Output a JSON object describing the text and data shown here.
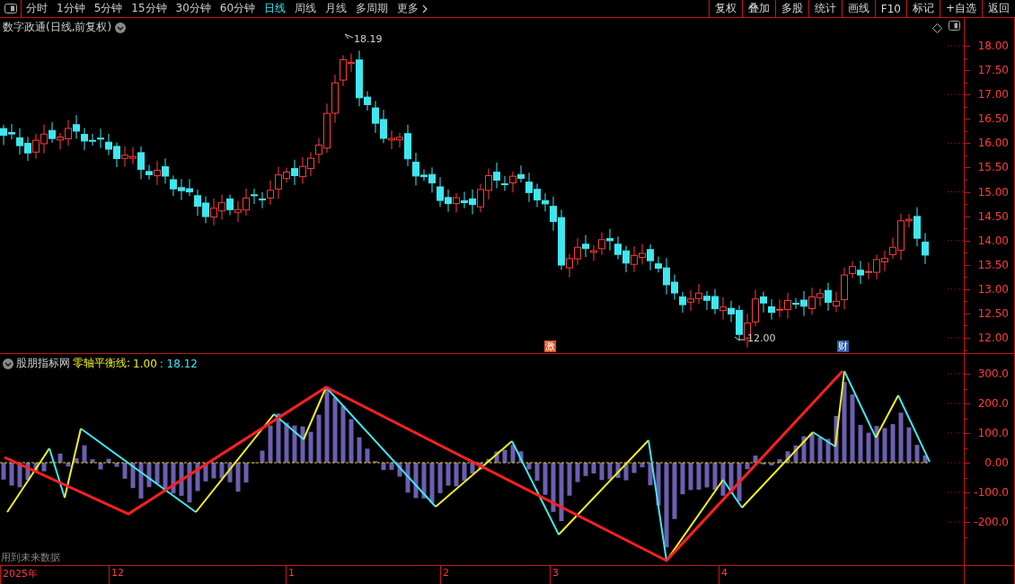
{
  "toolbar": {
    "periods": [
      {
        "label": "分时",
        "selected": false
      },
      {
        "label": "1分钟",
        "selected": false
      },
      {
        "label": "5分钟",
        "selected": false
      },
      {
        "label": "15分钟",
        "selected": false
      },
      {
        "label": "30分钟",
        "selected": false
      },
      {
        "label": "60分钟",
        "selected": false
      },
      {
        "label": "日线",
        "selected": true
      },
      {
        "label": "周线",
        "selected": false
      },
      {
        "label": "月线",
        "selected": false
      },
      {
        "label": "多周期",
        "selected": false
      }
    ],
    "more": "更多",
    "actions": [
      "复权",
      "叠加",
      "多股",
      "统计",
      "画线",
      "F10",
      "标记",
      "+自选",
      "返回"
    ]
  },
  "main_chart": {
    "title": "数字政通(日线,前复权)",
    "price_ticks": [
      "18.00",
      "17.50",
      "17.00",
      "16.50",
      "16.00",
      "15.50",
      "15.00",
      "14.50",
      "14.00",
      "13.50",
      "13.00",
      "12.50",
      "12.00"
    ],
    "high_label": "18.19",
    "low_label": "12.00",
    "event_marks": [
      {
        "label": "激",
        "color": "#d9531e"
      },
      {
        "label": "财",
        "color": "#2b5ca8"
      }
    ]
  },
  "indicator": {
    "name": "股朋指标网",
    "line_label": "零轴平衡线:",
    "value_1": "1.00",
    "value_2": ": 18.12",
    "ticks": [
      "300.0",
      "200.0",
      "100.0",
      "0.00",
      "-100.0",
      "-200.0"
    ],
    "warning": "用到未来数据"
  },
  "time_axis": [
    {
      "label": "2025年"
    },
    {
      "label": "12"
    },
    {
      "label": "1"
    },
    {
      "label": "2"
    },
    {
      "label": "3"
    },
    {
      "label": "4"
    }
  ]
}
